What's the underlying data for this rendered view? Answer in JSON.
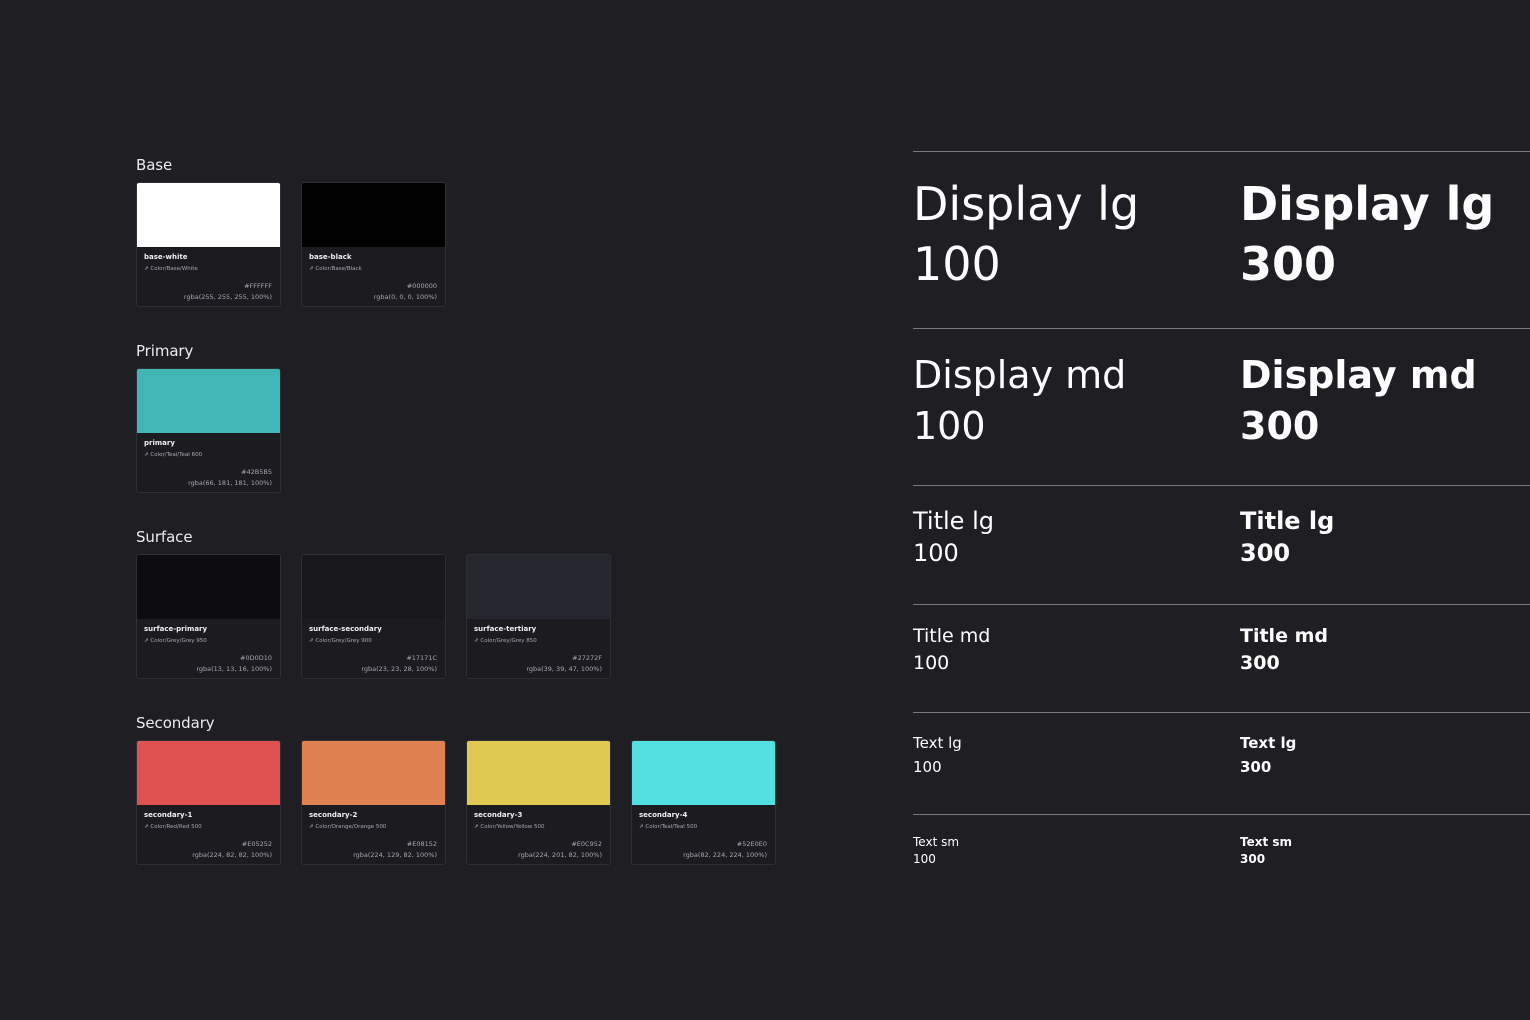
{
  "colors": {
    "base": {
      "title": "Base",
      "swatches": [
        {
          "token": "base-white",
          "alias": "⇗ Color/Base/White",
          "hex": "#FFFFFF",
          "rgba": "rgba(255, 255, 255, 100%)",
          "color": "#FFFFFF"
        },
        {
          "token": "base-black",
          "alias": "⇗ Color/Base/Black",
          "hex": "#000000",
          "rgba": "rgba(0, 0, 0, 100%)",
          "color": "#000000"
        }
      ]
    },
    "primary": {
      "title": "Primary",
      "swatches": [
        {
          "token": "primary",
          "alias": "⇗ Color/Teal/Teal 600",
          "hex": "#42B5B5",
          "rgba": "rgba(66, 181, 181, 100%)",
          "color": "#42B5B5"
        }
      ]
    },
    "surface": {
      "title": "Surface",
      "swatches": [
        {
          "token": "surface-primary",
          "alias": "⇗ Color/Grey/Grey 950",
          "hex": "#0D0D10",
          "rgba": "rgba(13, 13, 16, 100%)",
          "color": "#0D0D10"
        },
        {
          "token": "surface-secondary",
          "alias": "⇗ Color/Grey/Grey 900",
          "hex": "#17171C",
          "rgba": "rgba(23, 23, 28, 100%)",
          "color": "#17171C"
        },
        {
          "token": "surface-tertiary",
          "alias": "⇗ Color/Grey/Grey 850",
          "hex": "#27272F",
          "rgba": "rgba(39, 39, 47, 100%)",
          "color": "#27272F"
        }
      ]
    },
    "secondary": {
      "title": "Secondary",
      "swatches": [
        {
          "token": "secondary-1",
          "alias": "⇗ Color/Red/Red 500",
          "hex": "#E05252",
          "rgba": "rgba(224, 82, 82, 100%)",
          "color": "#E05252"
        },
        {
          "token": "secondary-2",
          "alias": "⇗ Color/Orange/Orange 500",
          "hex": "#E08152",
          "rgba": "rgba(224, 129, 82, 100%)",
          "color": "#E08152"
        },
        {
          "token": "secondary-3",
          "alias": "⇗ Color/Yellow/Yellow 500",
          "hex": "#E0C952",
          "rgba": "rgba(224, 201, 82, 100%)",
          "color": "#E0C952"
        },
        {
          "token": "secondary-4",
          "alias": "⇗ Color/Teal/Teal 500",
          "hex": "#52E0E0",
          "rgba": "rgba(82, 224, 224, 100%)",
          "color": "#52E0E0"
        }
      ]
    }
  },
  "typography": {
    "display_lg": {
      "light": {
        "name": "Display lg",
        "weight": "100"
      },
      "bold": {
        "name": "Display lg",
        "weight": "300"
      }
    },
    "display_md": {
      "light": {
        "name": "Display md",
        "weight": "100"
      },
      "bold": {
        "name": "Display md",
        "weight": "300"
      }
    },
    "title_lg": {
      "light": {
        "name": "Title lg",
        "weight": "100"
      },
      "bold": {
        "name": "Title lg",
        "weight": "300"
      }
    },
    "title_md": {
      "light": {
        "name": "Title md",
        "weight": "100"
      },
      "bold": {
        "name": "Title md",
        "weight": "300"
      }
    },
    "text_lg": {
      "light": {
        "name": "Text lg",
        "weight": "100"
      },
      "bold": {
        "name": "Text lg",
        "weight": "300"
      }
    },
    "text_sm": {
      "light": {
        "name": "Text sm",
        "weight": "100"
      },
      "bold": {
        "name": "Text sm",
        "weight": "300"
      }
    }
  }
}
